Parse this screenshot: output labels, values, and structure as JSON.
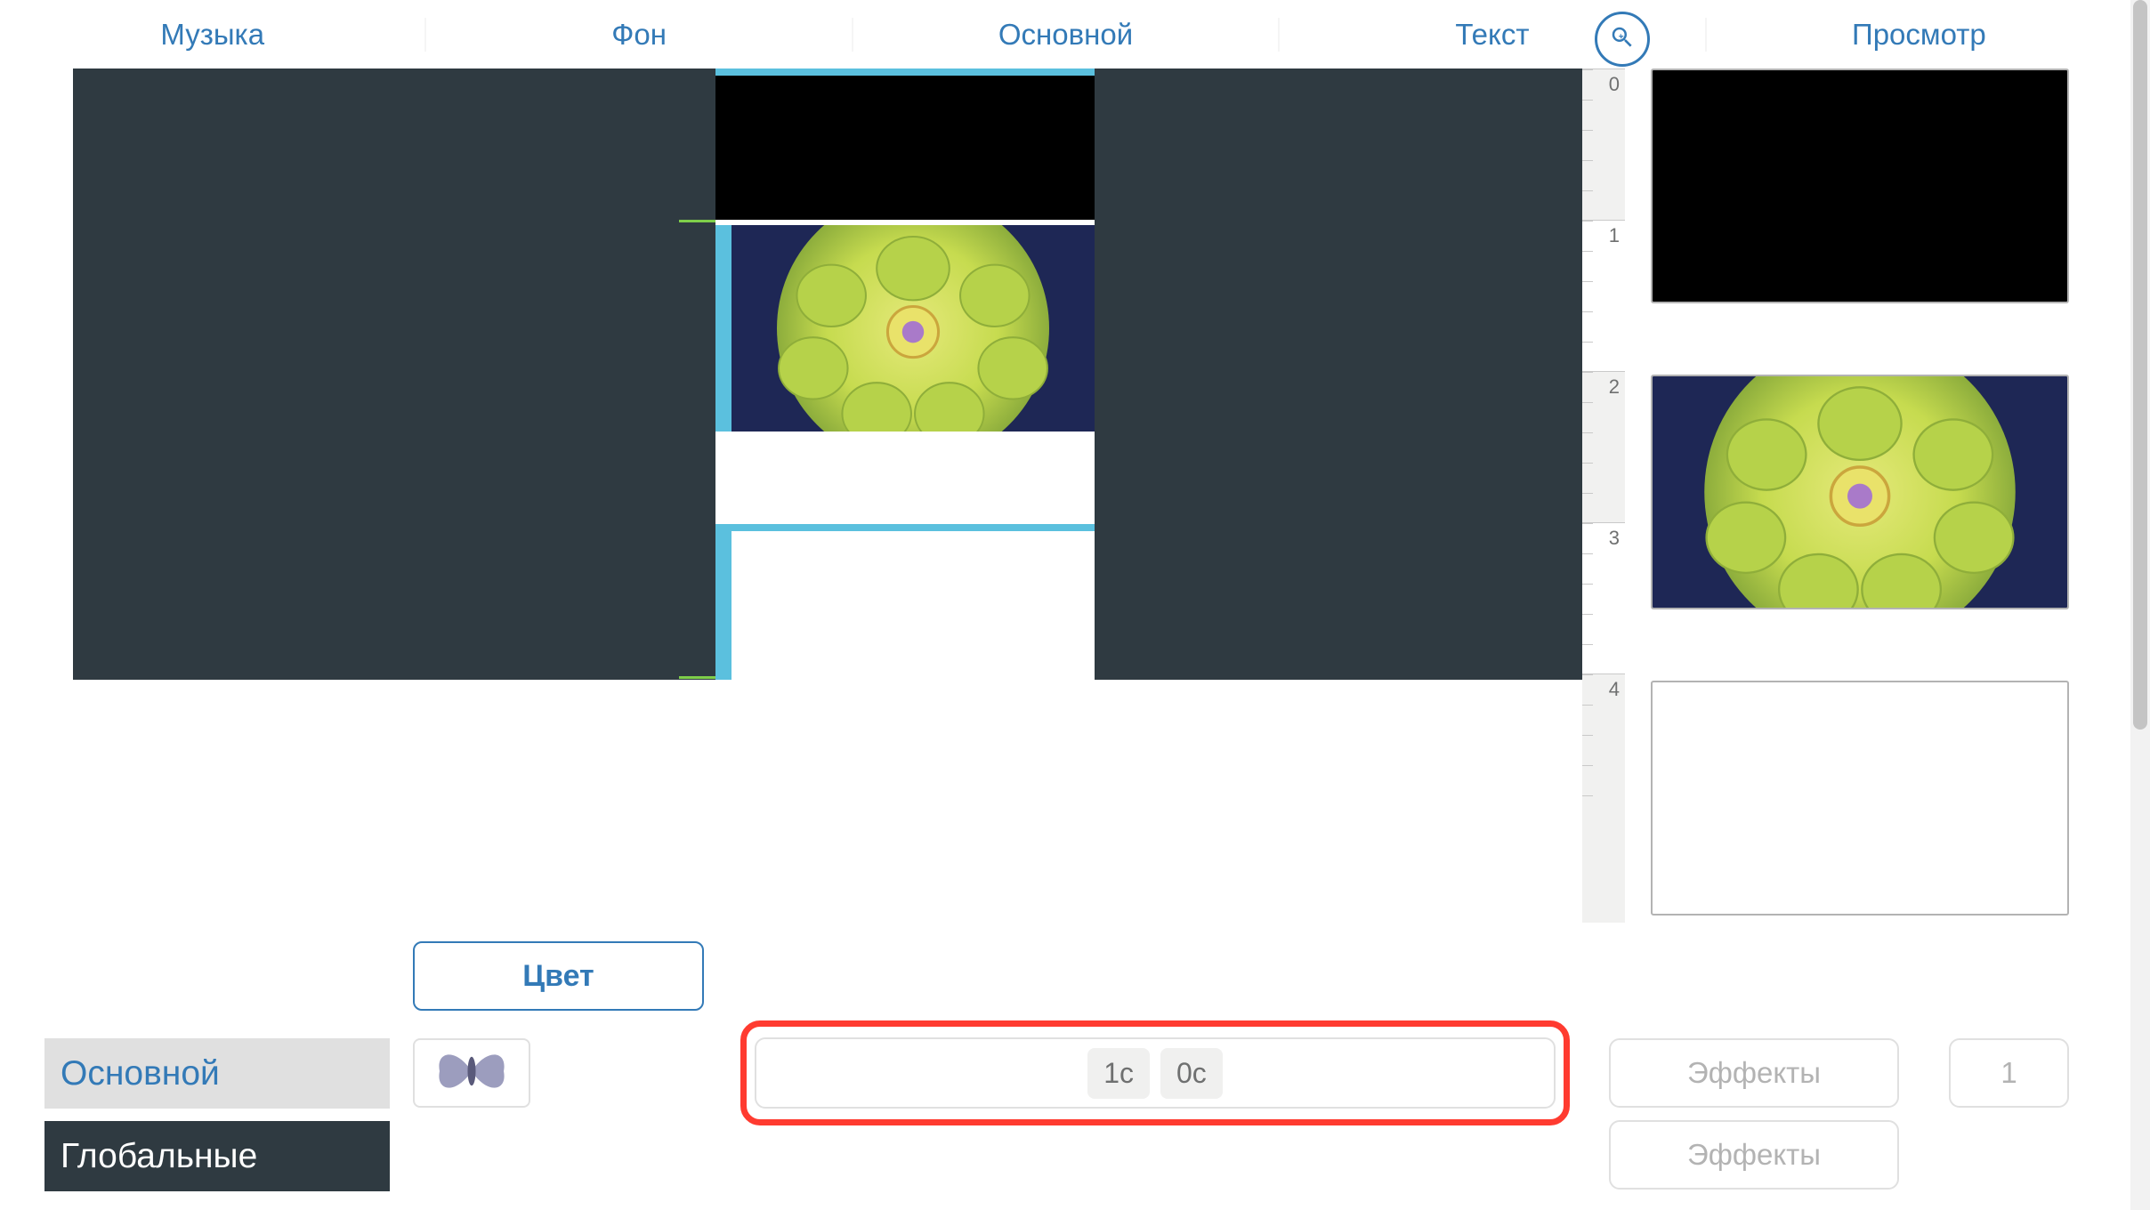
{
  "tabs": {
    "music": "Музыка",
    "background": "Фон",
    "main": "Основной",
    "text": "Текст",
    "preview": "Просмотр"
  },
  "ruler": [
    "0",
    "1",
    "2",
    "3",
    "4"
  ],
  "controls": {
    "color_label": "Цвет",
    "side_main": "Основной",
    "side_global": "Глобальные",
    "butterfly_icon": "butterfly-icon",
    "duration": {
      "in": "1с",
      "out": "0с"
    },
    "effects_label": "Эффекты",
    "number_value": "1"
  },
  "icons": {
    "zoom": "zoom-in-icon"
  }
}
